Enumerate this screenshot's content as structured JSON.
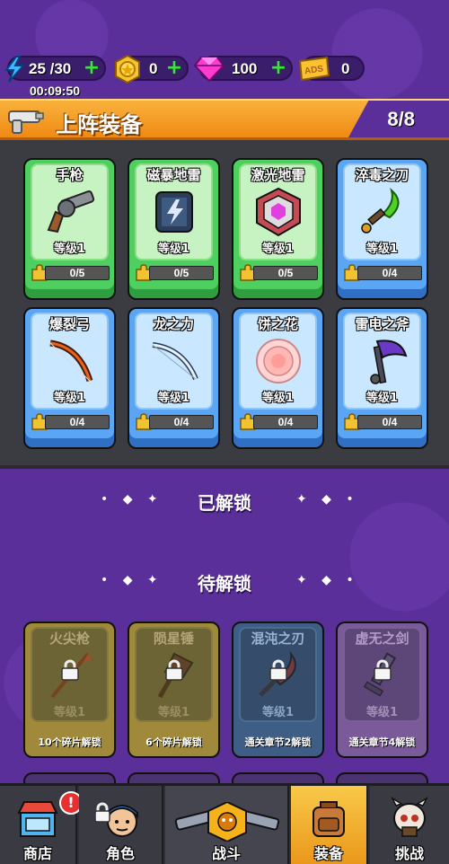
{
  "status": {
    "energy": "25 /30",
    "coins": "0",
    "gems": "100",
    "ads": "0",
    "ads_ticket_text": "ADS",
    "timer": "00:09:50"
  },
  "equipped": {
    "title": "上阵装备",
    "count": "8/8",
    "cards": [
      {
        "name": "手枪",
        "level": "等级1",
        "progress": "0/5",
        "progress_value": 0.0,
        "rarity": "green",
        "icon": "revolver-icon"
      },
      {
        "name": "磁暴地雷",
        "level": "等级1",
        "progress": "0/5",
        "progress_value": 0.0,
        "rarity": "green",
        "icon": "shock-mine-icon"
      },
      {
        "name": "激光地雷",
        "level": "等级1",
        "progress": "0/5",
        "progress_value": 0.0,
        "rarity": "green",
        "icon": "laser-mine-icon"
      },
      {
        "name": "淬毒之刃",
        "level": "等级1",
        "progress": "0/4",
        "progress_value": 0.0,
        "rarity": "blue",
        "icon": "poison-blade-icon"
      },
      {
        "name": "爆裂弓",
        "level": "等级1",
        "progress": "0/4",
        "progress_value": 0.0,
        "rarity": "blue",
        "icon": "fire-bow-icon"
      },
      {
        "name": "龙之力",
        "level": "等级1",
        "progress": "0/4",
        "progress_value": 0.0,
        "rarity": "blue",
        "icon": "dragon-bow-icon"
      },
      {
        "name": "饼之花",
        "level": "等级1",
        "progress": "0/4",
        "progress_value": 0.0,
        "rarity": "blue",
        "icon": "cake-flower-icon"
      },
      {
        "name": "雷电之斧",
        "level": "等级1",
        "progress": "0/4",
        "progress_value": 0.0,
        "rarity": "blue",
        "icon": "thunder-axe-icon"
      }
    ]
  },
  "sections": {
    "unlocked": "已解锁",
    "pending": "待解锁"
  },
  "locked": [
    {
      "name": "火尖枪",
      "level": "等级1",
      "unlock": "10个碎片解锁",
      "rarity": "olive",
      "icon": "fire-spear-icon"
    },
    {
      "name": "陨星锤",
      "level": "等级1",
      "unlock": "6个碎片解锁",
      "rarity": "olive",
      "icon": "meteor-hammer-icon"
    },
    {
      "name": "混沌之刃",
      "level": "等级1",
      "unlock": "通关章节2解锁",
      "rarity": "teal",
      "icon": "chaos-blade-icon"
    },
    {
      "name": "虚无之剑",
      "level": "等级1",
      "unlock": "通关章节4解锁",
      "rarity": "purple",
      "icon": "void-sword-icon"
    }
  ],
  "nav": {
    "shop": "商店",
    "character": "角色",
    "battle": "战斗",
    "equipment": "装备",
    "challenge": "挑战",
    "shop_badge": "!"
  }
}
